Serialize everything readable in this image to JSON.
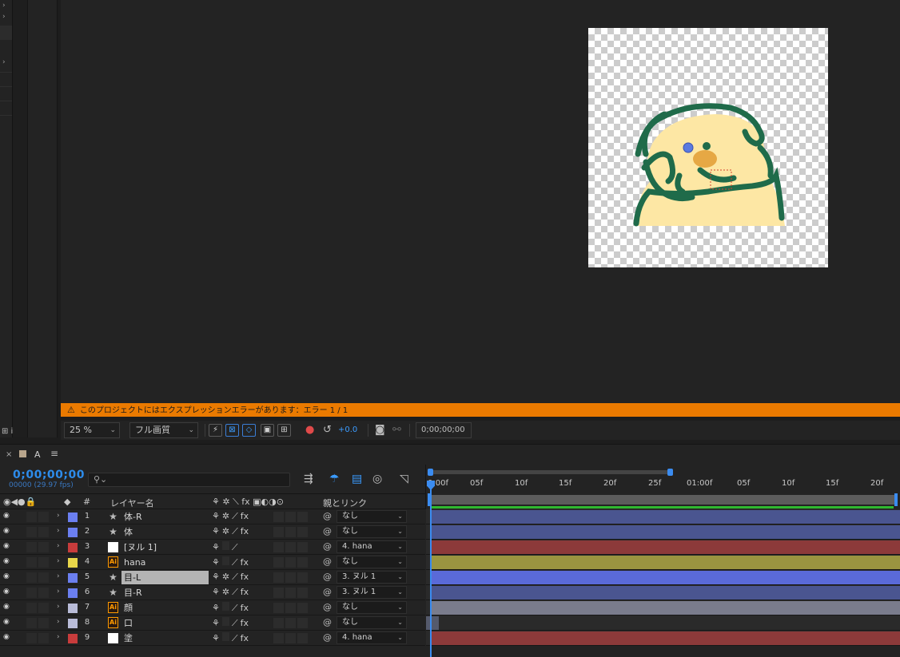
{
  "viewer": {
    "warning_text": "このプロジェクトにはエクスプレッションエラーがあります：エラー 1 / 1",
    "zoom": "25 %",
    "resolution": "フル画質",
    "exposure": "+0.0",
    "timecode": "0;00;00;00"
  },
  "timeline": {
    "comp_name": "A",
    "current_time": "0;00;00;00",
    "frame_info": "00000 (29.97 fps)",
    "search_placeholder": "",
    "columns": {
      "hash": "#",
      "layer_name": "レイヤー名",
      "switches": "fx",
      "parent": "親とリンク"
    },
    "ruler_ticks": [
      "0:00f",
      "05f",
      "10f",
      "15f",
      "20f",
      "25f",
      "01:00f",
      "05f",
      "10f",
      "15f",
      "20f"
    ],
    "layers": [
      {
        "num": "1",
        "type": "shape",
        "name": "体-R",
        "label_color": "#6b7ff0",
        "parent": "なし",
        "bar_color": "#4a5590"
      },
      {
        "num": "2",
        "type": "shape",
        "name": "体",
        "label_color": "#6b7ff0",
        "parent": "なし",
        "bar_color": "#4a5590"
      },
      {
        "num": "3",
        "type": "null",
        "name": "[ヌル 1]",
        "label_color": "#c83c3c",
        "parent": "4. hana",
        "bar_color": "#8c3a3a"
      },
      {
        "num": "4",
        "type": "ai",
        "name": "hana",
        "label_color": "#e8d64a",
        "parent": "なし",
        "bar_color": "#9a9440"
      },
      {
        "num": "5",
        "type": "shape",
        "name": "目-L",
        "label_color": "#6b7ff0",
        "parent": "3. ヌル 1",
        "bar_color": "#5a6ad8"
      },
      {
        "num": "6",
        "type": "shape",
        "name": "目-R",
        "label_color": "#6b7ff0",
        "parent": "3. ヌル 1",
        "bar_color": "#4a5590"
      },
      {
        "num": "7",
        "type": "ai",
        "name": "顔",
        "label_color": "#b9bcd8",
        "parent": "なし",
        "bar_color": "#7a7c8c"
      },
      {
        "num": "8",
        "type": "ai",
        "name": "口",
        "label_color": "#b9bcd8",
        "parent": "なし",
        "bar_color": "#555a6c"
      },
      {
        "num": "9",
        "type": "solid",
        "name": "塗",
        "label_color": "#c83c3c",
        "parent": "4. hana",
        "bar_color": "#8c3a3a"
      }
    ]
  }
}
